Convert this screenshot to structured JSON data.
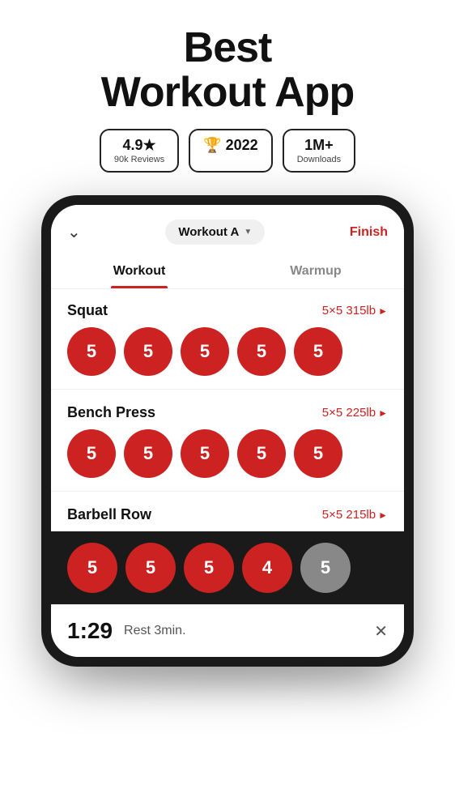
{
  "header": {
    "title_line1": "Best",
    "title_line2": "Workout App"
  },
  "badges": [
    {
      "id": "rating",
      "main": "4.9★",
      "sub": "90k Reviews"
    },
    {
      "id": "award",
      "main": "🏆 2022",
      "sub": ""
    },
    {
      "id": "downloads",
      "main": "1M+",
      "sub": "Downloads"
    }
  ],
  "app": {
    "chevron": "∨",
    "selector_label": "Workout A",
    "finish_label": "Finish",
    "tabs": [
      {
        "id": "workout",
        "label": "Workout",
        "active": true
      },
      {
        "id": "warmup",
        "label": "Warmup",
        "active": false
      }
    ],
    "exercises": [
      {
        "name": "Squat",
        "detail": "5×5 315lb",
        "sets": [
          5,
          5,
          5,
          5,
          5
        ],
        "inactive_indices": []
      },
      {
        "name": "Bench Press",
        "detail": "5×5 225lb",
        "sets": [
          5,
          5,
          5,
          5,
          5
        ],
        "inactive_indices": []
      },
      {
        "name": "Barbell Row",
        "detail": "5×5 215lb",
        "sets": [],
        "show_header_only": true
      }
    ],
    "bottom_sets": [
      5,
      5,
      5,
      4,
      5
    ],
    "bottom_inactive": [
      4
    ],
    "timer": {
      "time": "1:29",
      "label": "Rest 3min.",
      "close": "✕"
    }
  }
}
